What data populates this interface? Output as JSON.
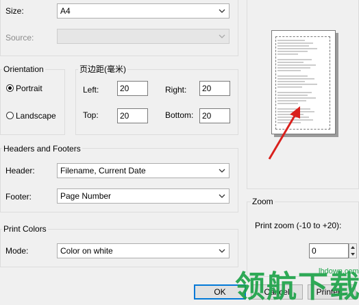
{
  "paper": {
    "size_label": "Size:",
    "size_value": "A4",
    "source_label": "Source:",
    "source_value": ""
  },
  "orientation": {
    "title": "Orientation",
    "portrait": "Portrait",
    "landscape": "Landscape",
    "selected": "Portrait"
  },
  "margins": {
    "title": "页边距(毫米)",
    "left_label": "Left:",
    "left_value": "20",
    "right_label": "Right:",
    "right_value": "20",
    "top_label": "Top:",
    "top_value": "20",
    "bottom_label": "Bottom:",
    "bottom_value": "20"
  },
  "headers_footers": {
    "title": "Headers and Footers",
    "header_label": "Header:",
    "header_value": "Filename, Current Date",
    "footer_label": "Footer:",
    "footer_value": "Page Number"
  },
  "print_colors": {
    "title": "Print Colors",
    "mode_label": "Mode:",
    "mode_value": "Color on white"
  },
  "zoom": {
    "title": "Zoom",
    "label": "Print zoom (-10 to +20):",
    "value": "0"
  },
  "buttons": {
    "ok": "OK",
    "cancel": "Cancel",
    "printer": "Printer..."
  },
  "watermark": {
    "text": "领航下载",
    "url": "lhdown.com"
  },
  "colors": {
    "arrow": "#d9201c",
    "watermark": "#1ea34a",
    "default_button_border": "#0078d7"
  }
}
